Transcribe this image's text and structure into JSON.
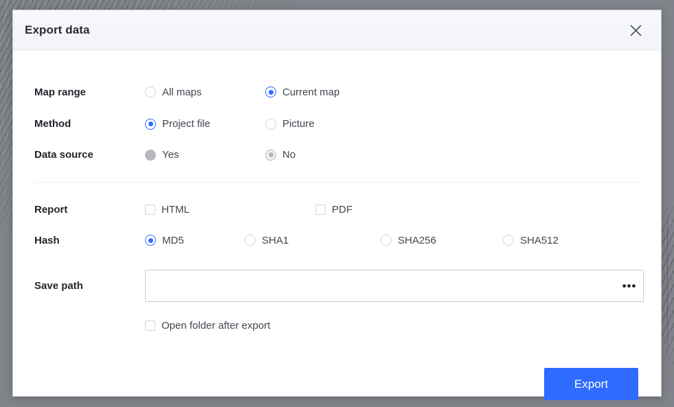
{
  "dialog": {
    "title": "Export data",
    "close_icon": "close-icon"
  },
  "colors": {
    "accent": "#2f6bff",
    "title_text": "#282b33",
    "label_text": "#1f2329",
    "option_text": "#41464f",
    "control_border": "#d2d5dc",
    "disabled_control": "#b4b7be",
    "input_border": "#c5cede",
    "divider": "#ebedf1",
    "titlebar_bg": "#f4f6fa",
    "dialog_bg": "#ffffff",
    "backdrop": "#808389"
  },
  "rows": {
    "map_range": {
      "label": "Map range",
      "options": [
        {
          "label": "All maps",
          "type": "radio",
          "checked": false,
          "disabled": false
        },
        {
          "label": "Current map",
          "type": "radio",
          "checked": true,
          "disabled": false
        }
      ]
    },
    "method": {
      "label": "Method",
      "options": [
        {
          "label": "Project file",
          "type": "radio",
          "checked": true,
          "disabled": false
        },
        {
          "label": "Picture",
          "type": "radio",
          "checked": false,
          "disabled": false
        }
      ]
    },
    "data_source": {
      "label": "Data source",
      "options": [
        {
          "label": "Yes",
          "type": "radio",
          "checked": false,
          "disabled": true
        },
        {
          "label": "No",
          "type": "radio",
          "checked": true,
          "disabled": true
        }
      ]
    },
    "report": {
      "label": "Report",
      "options": [
        {
          "label": "HTML",
          "type": "checkbox",
          "checked": false
        },
        {
          "label": "PDF",
          "type": "checkbox",
          "checked": false
        }
      ]
    },
    "hash": {
      "label": "Hash",
      "options": [
        {
          "label": "MD5",
          "type": "radio",
          "checked": true
        },
        {
          "label": "SHA1",
          "type": "radio",
          "checked": false
        },
        {
          "label": "SHA256",
          "type": "radio",
          "checked": false
        },
        {
          "label": "SHA512",
          "type": "radio",
          "checked": false
        }
      ]
    },
    "save_path": {
      "label": "Save path",
      "value": "",
      "placeholder": "",
      "browse_label": "•••"
    },
    "open_folder": {
      "label": "Open folder after export",
      "checked": false
    }
  },
  "footer": {
    "export_label": "Export"
  }
}
